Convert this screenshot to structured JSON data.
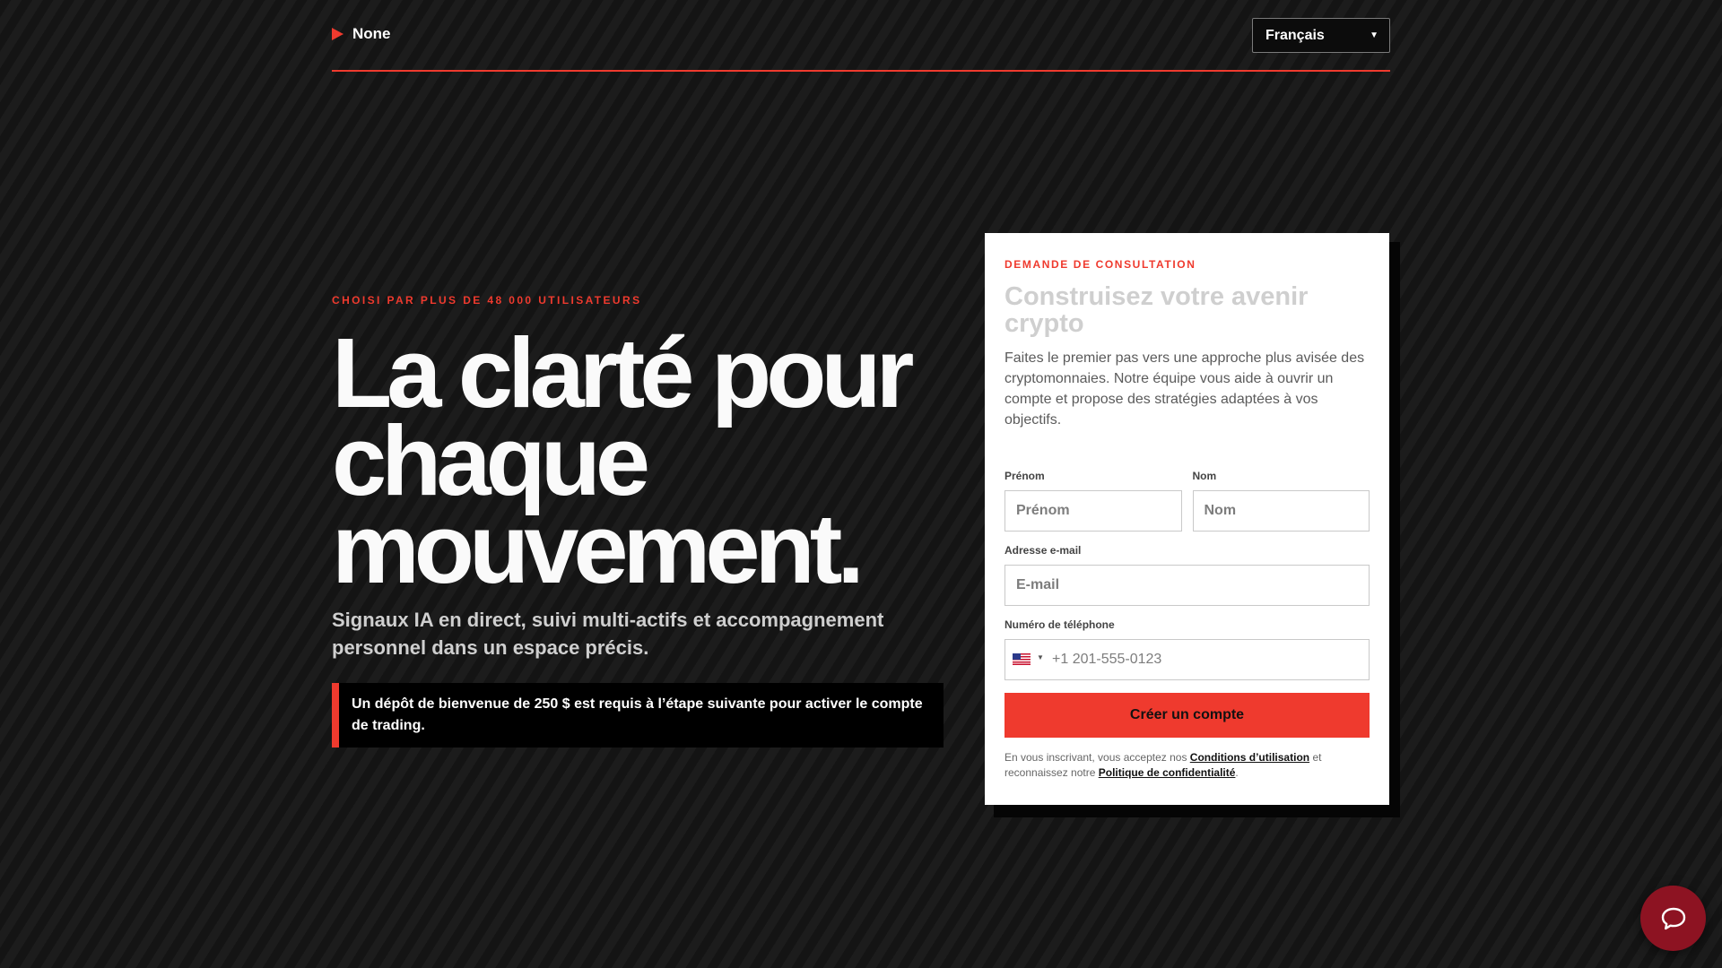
{
  "header": {
    "brand": "None",
    "language": "Français"
  },
  "hero": {
    "eyebrow": "CHOISI PAR PLUS DE 48 000 UTILISATEURS",
    "title_lines": [
      "La clarté pour",
      "chaque",
      "mouvement."
    ],
    "subtitle": "Signaux IA en direct, suivi multi-actifs et accompagnement personnel dans un espace précis.",
    "notice": "Un dépôt de bienvenue de 250 $ est requis à l’étape suivante pour activer le compte de trading."
  },
  "card": {
    "eyebrow": "DEMANDE DE CONSULTATION",
    "title": "Construisez votre avenir crypto",
    "description": "Faites le premier pas vers une approche plus avisée des cryptomonnaies. Notre équipe vous aide à ouvrir un compte et propose des stratégies adaptées à vos objectifs.",
    "fields": {
      "first_name_label": "Prénom",
      "first_name_placeholder": "Prénom",
      "last_name_label": "Nom",
      "last_name_placeholder": "Nom",
      "email_label": "Adresse e-mail",
      "email_placeholder": "E-mail",
      "phone_label": "Numéro de téléphone",
      "phone_placeholder": "+1 201-555-0123"
    },
    "submit_label": "Créer un compte",
    "legal": {
      "prefix": "En vous inscrivant, vous acceptez nos ",
      "terms": "Conditions d’utilisation",
      "middle": " et reconnaissez notre ",
      "privacy": "Politique de confidentialité",
      "suffix": "."
    }
  },
  "icons": {
    "brand": "play-triangle-icon",
    "language": "chevron-down-icon",
    "phone": "us-flag-icon",
    "chat": "chat-bubble-icon"
  },
  "colors": {
    "accent": "#ef3a2e",
    "chat_button": "#8d1322"
  }
}
